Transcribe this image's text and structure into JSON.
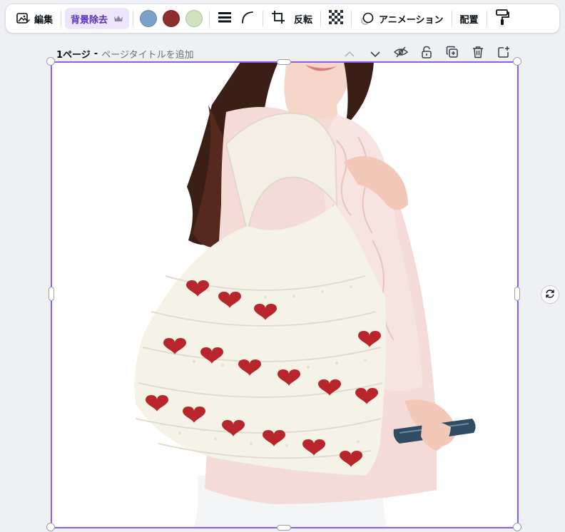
{
  "toolbar": {
    "edit_label": "編集",
    "bg_remove_label": "背景除去",
    "colors": [
      "#7aa3c8",
      "#8c2f2a",
      "#cfe3bf"
    ],
    "flip_label": "反転",
    "animation_label": "アニメーション",
    "position_label": "配置"
  },
  "page": {
    "number_label": "1ページ",
    "separator": "-",
    "title_placeholder": "ページタイトルを追加"
  },
  "icons": [
    "image-edit-icon",
    "crown-icon",
    "border-style-icon",
    "corner-rounding-icon",
    "crop-icon",
    "transparency-icon",
    "animation-icon",
    "paint-roller-icon",
    "chevron-up-icon",
    "chevron-down-icon",
    "hide-icon",
    "lock-icon",
    "duplicate-icon",
    "trash-icon",
    "add-page-icon",
    "rotate-icon"
  ],
  "accent_color": "#8b5cf6"
}
